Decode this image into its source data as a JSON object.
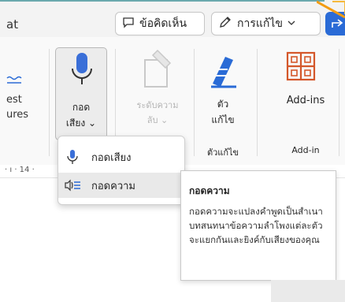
{
  "title_fragment": "at",
  "header": {
    "comments_label": "ข้อคิดเห็น",
    "editing_label": "การแก้ไข"
  },
  "ribbon": {
    "partial_group_line1": "est",
    "partial_group_line2": "ures",
    "dictate": {
      "line1": "กอด",
      "line2": "เสียง ⌄"
    },
    "sensitivity": {
      "line1": "ระดับความ",
      "line2": "ลับ ⌄"
    },
    "editor": {
      "line1": "ตัว",
      "line2": "แก้ไข",
      "group": "ตัวแก้ไข"
    },
    "addins": {
      "label": "Add-ins",
      "group": "Add-in"
    }
  },
  "ruler_text": "· ı · 14 ·",
  "menu": {
    "items": [
      {
        "label": "กอดเสียง",
        "icon": "microphone-icon"
      },
      {
        "label": "กอดความ",
        "icon": "transcribe-icon"
      }
    ]
  },
  "tooltip": {
    "title": "กอดความ",
    "body": "กอดความจะแปลงคำพูดเป็นสำเนาบทสนทนาข้อความลำโพงแต่ละตัวจะแยกกันและยิงค์กับเสียงของคุณ"
  },
  "colors": {
    "accent_blue": "#2a6bd6",
    "mic_blue": "#3a6fd8",
    "addins_orange": "#d4572a",
    "corner_orange": "#f39c12"
  }
}
